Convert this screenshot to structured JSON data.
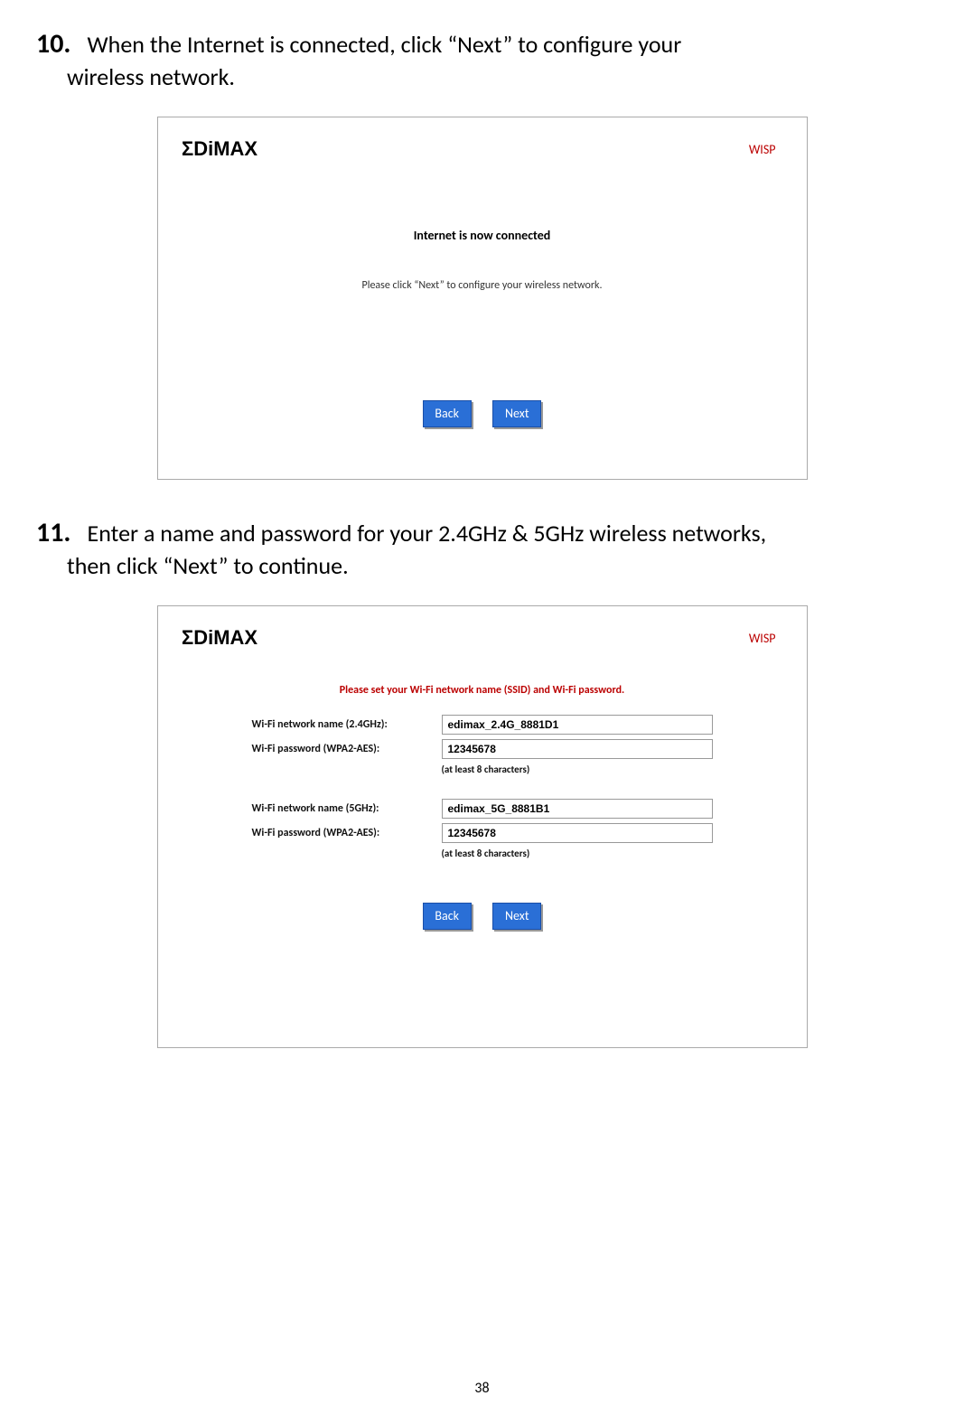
{
  "steps": {
    "s10": {
      "num": "10.",
      "line1": "When the Internet is connected, click “Next” to configure your",
      "line2": "wireless network."
    },
    "s11": {
      "num": "11.",
      "line1": "Enter a name and password for your 2.4GHz & 5GHz wireless networks,",
      "line2": "then click “Next” to continue."
    }
  },
  "panel1": {
    "mode": "WISP",
    "status": "Internet is now connected",
    "instruction": "Please click “Next” to configure your wireless network.",
    "back": "Back",
    "next": "Next"
  },
  "panel2": {
    "mode": "WISP",
    "instruction": "Please set your Wi-Fi network name (SSID) and Wi-Fi password.",
    "g24": {
      "name_label": "Wi-Fi network name (2.4GHz):",
      "name_value": "edimax_2.4G_8881D1",
      "pw_label": "Wi-Fi password (WPA2-AES):",
      "pw_value": "12345678",
      "hint": "(at least 8 characters)"
    },
    "g5": {
      "name_label": "Wi-Fi network name (5GHz):",
      "name_value": "edimax_5G_8881B1",
      "pw_label": "Wi-Fi password (WPA2-AES):",
      "pw_value": "12345678",
      "hint": "(at least 8 characters)"
    },
    "back": "Back",
    "next": "Next"
  },
  "page_number": "38"
}
